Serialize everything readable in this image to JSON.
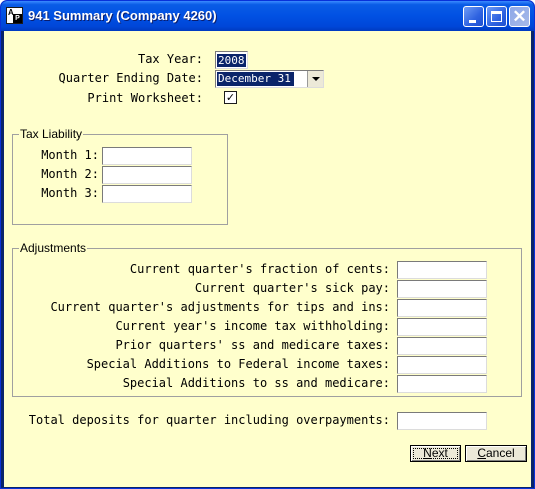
{
  "window": {
    "title": "941 Summary (Company 4260)",
    "icon": "app-icon",
    "controls": [
      "minimize-icon",
      "maximize-icon",
      "close-icon"
    ]
  },
  "form": {
    "tax_year": {
      "label": "Tax Year:",
      "value": "2008"
    },
    "quarter_ending": {
      "label": "Quarter Ending Date:",
      "value": "December 31"
    },
    "print_worksheet": {
      "label": "Print Worksheet:",
      "checked": true,
      "mark": "✓"
    }
  },
  "tax_liability": {
    "title": "Tax Liability",
    "months": [
      {
        "label": "Month 1:",
        "value": ""
      },
      {
        "label": "Month 2:",
        "value": ""
      },
      {
        "label": "Month 3:",
        "value": ""
      }
    ]
  },
  "adjustments": {
    "title": "Adjustments",
    "rows": [
      {
        "label": "Current quarter's fraction of cents:",
        "value": ""
      },
      {
        "label": "Current quarter's sick pay:",
        "value": ""
      },
      {
        "label": "Current quarter's adjustments for tips and ins:",
        "value": ""
      },
      {
        "label": "Current year's income tax withholding:",
        "value": ""
      },
      {
        "label": "Prior quarters' ss and medicare taxes:",
        "value": ""
      },
      {
        "label": "Special Additions to Federal income taxes:",
        "value": ""
      },
      {
        "label": "Special Additions to ss and medicare:",
        "value": ""
      }
    ]
  },
  "total_deposits": {
    "label": "Total deposits for quarter including overpayments:",
    "value": ""
  },
  "buttons": {
    "next": {
      "label": "Next",
      "underline": "N",
      "rest": "ext"
    },
    "cancel": {
      "label": "Cancel",
      "underline": "C",
      "rest": "ancel"
    }
  },
  "colors": {
    "client_background": "#ffffcc",
    "titlebar": "#0151e3",
    "selection": "#0a246a"
  }
}
